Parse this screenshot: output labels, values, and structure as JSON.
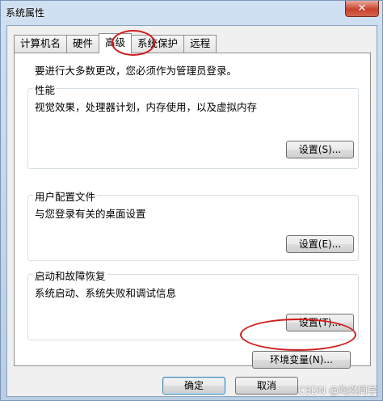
{
  "window": {
    "title": "系统属性",
    "close_symbol": "✕"
  },
  "tabs": [
    {
      "label": "计算机名"
    },
    {
      "label": "硬件"
    },
    {
      "label": "高级",
      "active": true
    },
    {
      "label": "系统保护"
    },
    {
      "label": "远程"
    }
  ],
  "panel": {
    "admin_note": "要进行大多数更改，您必须作为管理员登录。",
    "performance": {
      "title": "性能",
      "description": "视觉效果，处理器计划，内存使用，以及虚拟内存",
      "button": "设置(S)..."
    },
    "user_profiles": {
      "title": "用户配置文件",
      "description": "与您登录有关的桌面设置",
      "button": "设置(E)..."
    },
    "startup_recovery": {
      "title": "启动和故障恢复",
      "description": "系统启动、系统失败和调试信息",
      "button": "设置(T)..."
    },
    "env_button": "环境变量(N)..."
  },
  "footer": {
    "ok": "确定",
    "cancel": "取消"
  },
  "watermark": "CSDN @陶然同学",
  "annotation_color": "#d21d1d"
}
